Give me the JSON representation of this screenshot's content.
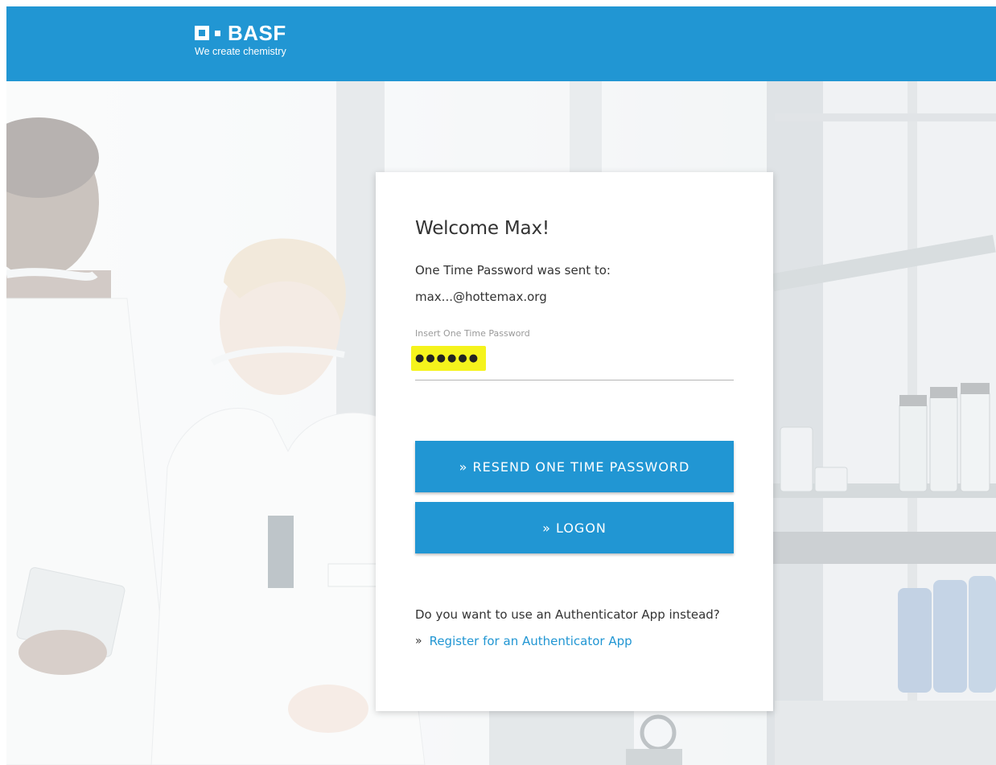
{
  "colors": {
    "brand": "#2196d3",
    "highlight": "#f5f31c",
    "text": "#333333"
  },
  "header": {
    "logo_text": "BASF",
    "tagline": "We create chemistry"
  },
  "card": {
    "welcome": "Welcome Max!",
    "sent_to_label": "One Time Password was sent to:",
    "email": "max...@hottemax.org",
    "otp_label": "Insert One Time Password",
    "otp_value": "●●●●●●",
    "resend_button": "» RESEND ONE TIME PASSWORD",
    "logon_button": "» LOGON",
    "authenticator_question": "Do you want to use an Authenticator App instead?",
    "authenticator_bullet": "»",
    "authenticator_link": "Register for an Authenticator App"
  },
  "icons": {
    "logo": "basf-logo-icon"
  }
}
